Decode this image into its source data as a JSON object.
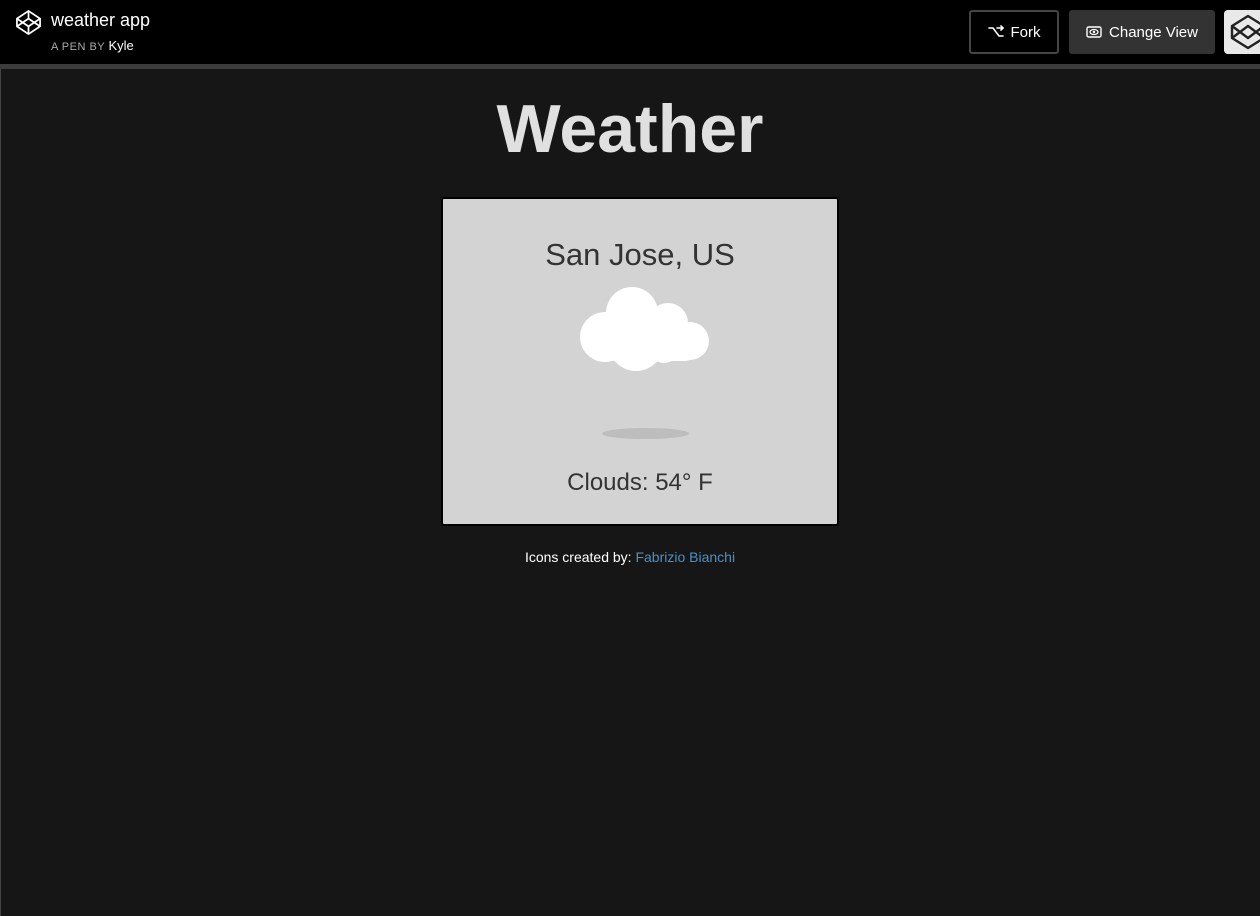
{
  "header": {
    "pen_title": "weather app",
    "pen_by_prefix": "A PEN BY",
    "author": "Kyle",
    "fork_label": "Fork",
    "change_view_label": "Change View",
    "logo_icon": "codepen-logo-icon",
    "fork_icon": "fork-icon",
    "change_view_icon": "eye-icon"
  },
  "main": {
    "title": "Weather",
    "location": "San Jose, US",
    "conditions": "Clouds: 54° F",
    "weather_icon": "cloud-icon"
  },
  "footer": {
    "credits_prefix": "Icons created by:",
    "credits_link": "Fabrizio Bianchi",
    "link_color": "#4a90c8"
  },
  "colors": {
    "background": "#161616",
    "topbar": "#000000",
    "card": "#d3d3d3"
  }
}
